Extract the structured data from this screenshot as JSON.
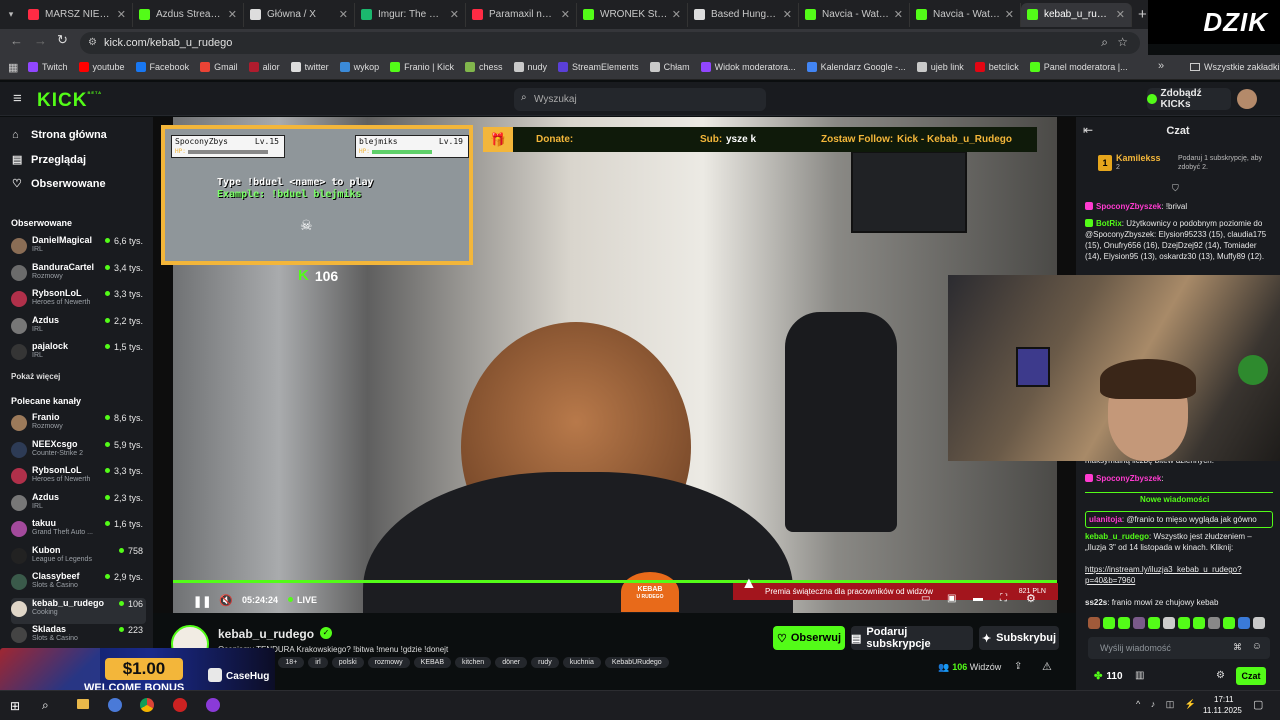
{
  "browser": {
    "tabs": [
      {
        "label": "MARSZ NIEPODLEG",
        "color": "#ff2b44"
      },
      {
        "label": "Azdus Stream - W",
        "color": "#53fc18"
      },
      {
        "label": "Główna / X",
        "color": "#dddddd"
      },
      {
        "label": "Imgur: The magic",
        "color": "#1bb76e"
      },
      {
        "label": "Paramaxil najleps",
        "color": "#ff2b44"
      },
      {
        "label": "WRONEK Stream",
        "color": "#53fc18"
      },
      {
        "label": "Based Hungary w",
        "color": "#dddddd"
      },
      {
        "label": "Navcia - Watch cl",
        "color": "#53fc18"
      },
      {
        "label": "Navcia - Watch th",
        "color": "#53fc18"
      },
      {
        "label": "kebab_u_rudego",
        "color": "#53fc18",
        "active": true
      }
    ],
    "url": "kick.com/kebab_u_rudego",
    "overlay_brand": "DZIK",
    "bookmarks": [
      {
        "label": "Twitch",
        "color": "#9146ff"
      },
      {
        "label": "youtube",
        "color": "#ff0000"
      },
      {
        "label": "Facebook",
        "color": "#1877f2"
      },
      {
        "label": "Gmail",
        "color": "#ea4335"
      },
      {
        "label": "alior",
        "color": "#b01c2e"
      },
      {
        "label": "twitter",
        "color": "#dddddd"
      },
      {
        "label": "wykop",
        "color": "#3b8ad8"
      },
      {
        "label": "Franio | Kick",
        "color": "#53fc18"
      },
      {
        "label": "chess",
        "color": "#81b64c"
      },
      {
        "label": "nudy",
        "color": "#c9c9c9"
      },
      {
        "label": "StreamElements",
        "color": "#5a3fd8"
      },
      {
        "label": "Chłam",
        "color": "#c9c9c9"
      },
      {
        "label": "Widok moderatora...",
        "color": "#9146ff"
      },
      {
        "label": "Kalendarz Google -...",
        "color": "#4285f4"
      },
      {
        "label": "ujeb link",
        "color": "#c9c9c9"
      },
      {
        "label": "betclick",
        "color": "#e30613"
      },
      {
        "label": "Panel moderatora |...",
        "color": "#53fc18"
      }
    ],
    "all_bookmarks": "Wszystkie zakładki"
  },
  "kick": {
    "logo": "KICK",
    "logo_sup": "BETA",
    "search_placeholder": "Wyszukaj",
    "get_kicks": "Zdobądź KICKs"
  },
  "sidebar": {
    "nav": [
      {
        "label": "Strona główna",
        "icon": "⌂"
      },
      {
        "label": "Przeglądaj",
        "icon": "▤"
      },
      {
        "label": "Obserwowane",
        "icon": "♡"
      }
    ],
    "followed_title": "Obserwowane",
    "followed": [
      {
        "name": "DanielMagical",
        "category": "IRL",
        "viewers": "6,6 tys.",
        "color": "#8a6d55"
      },
      {
        "name": "BanduraCartel",
        "category": "Rozmowy",
        "viewers": "3,4 tys.",
        "color": "#6b6b6b"
      },
      {
        "name": "RybsonLoL",
        "category": "Heroes of Newerth",
        "viewers": "3,3 tys.",
        "color": "#b0304a"
      },
      {
        "name": "Azdus",
        "category": "IRL",
        "viewers": "2,2 tys.",
        "color": "#777777"
      },
      {
        "name": "pajalock",
        "category": "IRL",
        "viewers": "1,5 tys.",
        "color": "#353535"
      }
    ],
    "show_more": "Pokaż więcej",
    "recommended_title": "Polecane kanały",
    "recommended": [
      {
        "name": "Franio",
        "category": "Rozmowy",
        "viewers": "8,6 tys.",
        "color": "#9c7a5a"
      },
      {
        "name": "NEEXcsgo",
        "category": "Counter-Strike 2",
        "viewers": "5,9 tys.",
        "color": "#2d3b55"
      },
      {
        "name": "RybsonLoL",
        "category": "Heroes of Newerth",
        "viewers": "3,3 tys.",
        "color": "#b0304a"
      },
      {
        "name": "Azdus",
        "category": "IRL",
        "viewers": "2,3 tys.",
        "color": "#777777"
      },
      {
        "name": "takuu",
        "category": "Grand Theft Auto ...",
        "viewers": "1,6 tys.",
        "color": "#a34a9c"
      },
      {
        "name": "Kubon",
        "category": "League of Legends",
        "viewers": "758",
        "color": "#222222"
      },
      {
        "name": "Classybeef",
        "category": "Slots & Casino",
        "viewers": "2,9 tys.",
        "color": "#3a5a4a"
      },
      {
        "name": "kebab_u_rudego",
        "category": "Cooking",
        "viewers": "106",
        "color": "#e0d6c8",
        "selected": true
      },
      {
        "name": "Skladas",
        "category": "Slots & Casino",
        "viewers": "223",
        "color": "#444444"
      }
    ],
    "show_more_bottom": "Pokaż"
  },
  "player": {
    "donate_label": "Donate:",
    "sub_label": "Sub:",
    "sub_value": "ysze k",
    "follow_label": "Zostaw Follow:",
    "follow_value": "Kick - Kebab_u_Rudego",
    "game": {
      "p1_name": "SpoconyZbys",
      "p1_lvl": "Lv.15",
      "p2_name": "blejmiks",
      "p2_lvl": "Lv.19",
      "hp_label": "HP:",
      "line1": "Type !bduel <name> to play",
      "line2": "Example: !bduel blejmiks"
    },
    "k_count": "106",
    "time": "05:24:24",
    "live": "LIVE",
    "premia": "Premia świąteczna dla pracowników od widzów",
    "premia_amount": "821 PLN",
    "cap_brand": "KEBAB",
    "cap_sub": "U RUDEGO"
  },
  "stream": {
    "channel": "kebab_u_rudego",
    "title": "Oceniamy TENDURA Krakowskiego? !bitwa !menu !gdzie !donejt",
    "tags": [
      "sh",
      "18+",
      "irl",
      "polski",
      "rozmowy",
      "KEBAB",
      "kitchen",
      "döner",
      "rudy",
      "kuchnia",
      "KebabURudego"
    ],
    "follow_btn": "Obserwuj",
    "gift_btn": "Podaruj subskrypcje",
    "sub_btn": "Subskrybuj",
    "viewers": "106",
    "viewers_label": "Widzów"
  },
  "chat": {
    "title": "Czat",
    "pinned_user": "Kamilekss",
    "pinned_count": "2",
    "pinned_text": "Podaruj 1 subskrypcję, aby zdobyć 2.",
    "messages": [
      {
        "user": "SpoconyZbyszek",
        "color": "#ff3bd0",
        "text": "!brival"
      },
      {
        "user": "BotRix",
        "color": "#53fc18",
        "text": "Użytkownicy o podobnym poziomie do @SpoconyZbyszek: Elysion95233 (15), claudia175 (15), Onufry656 (16), DzejDzej92 (14), Tomiader (14), Elysion95 (13), oskardz30 (13), Muffy89 (12)."
      },
      {
        "user": "",
        "color": "#e8e8e8",
        "text": "maksymalną liczbę bitew dziennych."
      },
      {
        "user": "SpoconyZbyszek",
        "color": "#ff3bd0",
        "text": ""
      }
    ],
    "new_messages": "Nowe wiadomości",
    "new": [
      {
        "user": "ulanitoja",
        "color": "#ff3bd0",
        "text": "@franio to mięso wygląda jak gówno"
      },
      {
        "user": "kebab_u_rudego",
        "color": "#53fc18",
        "text": "Wszystko jest złudzeniem – „Iluzja 3\" od 14 listopada w kinach. Kliknij:"
      },
      {
        "user": "",
        "color": "#e8e8e8",
        "text": "https://instream.ly/iluzja3_kebab_u_rudego?p=40&b=7960"
      },
      {
        "user": "ss22s",
        "color": "#e8e8e8",
        "text": "franio mowi ze chujowy kebab"
      }
    ],
    "input_placeholder": "Wyślij wiadomość",
    "points": "110",
    "send_btn": "Czat"
  },
  "ad": {
    "amount": "$1.00",
    "text": "WELCOME BONUS",
    "brand": "CaseHug"
  },
  "taskbar": {
    "time": "17:11",
    "date": "11.11.2025"
  }
}
